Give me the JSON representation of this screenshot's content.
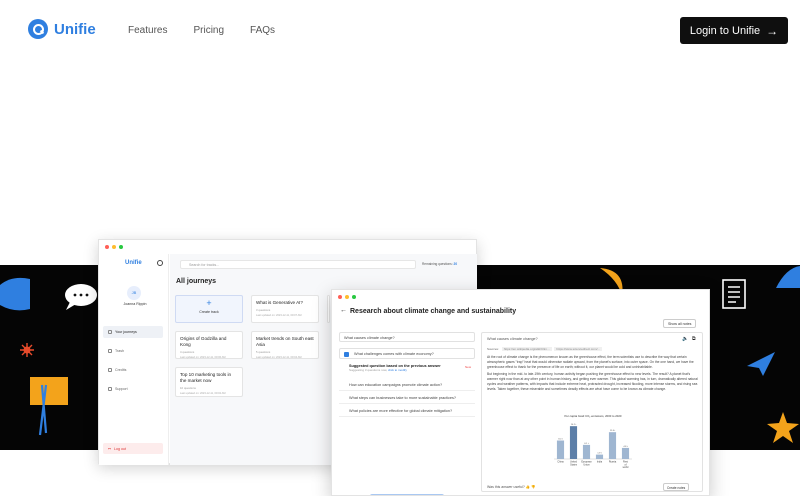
{
  "brand": {
    "name": "Unifie",
    "color": "#2f7fe0"
  },
  "nav": {
    "items": [
      "Features",
      "Pricing",
      "FAQs"
    ]
  },
  "login": {
    "label": "Login to Unifie",
    "icon": "arrow-right-icon"
  },
  "app1": {
    "logo": "Unifie",
    "avatar_initials": "JB",
    "user_name": "Joanna Rippin",
    "sidebar": [
      "Your journeys",
      "Trash",
      "Credits",
      "Support"
    ],
    "logout": "Log out",
    "search_placeholder": "Search for tracks...",
    "remaining_label": "Remaining questions:",
    "remaining_value": "20",
    "heading": "All journeys",
    "create_label": "Create track",
    "cards": [
      {
        "title": "What is Generative AI?",
        "sub": "3 questions",
        "meta": "Last updated on: 2023-12-11, 09:07 AM"
      },
      {
        "title": "Origins of Godzilla and Kong",
        "sub": "4 questions",
        "meta": "Last updated on: 2023-12-11, 09:06 AM"
      },
      {
        "title": "Market trends on South east Asia",
        "sub": "5 questions",
        "meta": "Last updated on: 2023-12-11, 09:04 AM"
      },
      {
        "title": "Top 10 marketing tools in the market now",
        "sub": "10 questions",
        "meta": "Last updated on: 2023-12-11, 09:02 AM"
      }
    ]
  },
  "app2": {
    "title": "Research about climate change and sustainability",
    "show_notes": "Show all notes",
    "q1": "What causes climate change?",
    "q2": "What challenges comes with climate economy?",
    "suggested_title": "Suggested question based on the previous answer",
    "suggested_sub": "Suggesting 3 questions now,",
    "suggested_link": "click to modify",
    "new_label": "New",
    "suggestions": [
      "How can education campaigns promote climate action?",
      "What steps can businesses take to more sustainable practices?",
      "What policies are more effective for global climate mitigation?"
    ],
    "answer_heading": "What causes climate change?",
    "sources_label": "Sources:",
    "sources": [
      "https://en.wikipedia.org/wiki/Clim...",
      "https://www.sciencedirect.com/..."
    ],
    "answer_p1": "At the root of climate change is the phenomenon known as the greenhouse effect, the term scientists use to describe the way that certain atmospheric gases \"trap\" heat that would otherwise radiate upward, from the planet's surface, into outer space. On the one hand, we have the greenhouse effect to thank for the presence of life on earth; without it, our planet would be cold and uninhabitable.",
    "answer_p2": "But beginning in the mid- to late-19th century, human activity began pushing the greenhouse effect to new levels. The result? A planet that's warmer right now than at any other point in human history, and getting ever warmer. This global warming has, in turn, dramatically altered natural cycles and weather patterns, with impacts that include extreme heat, protracted drought, increased flooding, more intense storms, and rising sea levels. Taken together, these miserable and sometimes deadly effects are what have come to be known as climate change.",
    "feedback": "Was this answer useful?",
    "create_notes": "Create notes"
  },
  "chart_data": {
    "type": "bar",
    "title": "Per capita fossil CO₂ emissions, 2000 to 2020",
    "categories": [
      "China",
      "United States",
      "European Union",
      "India",
      "Russia",
      "Rest of world"
    ],
    "values": [
      8.0,
      14.2,
      6.1,
      1.9,
      11.6,
      4.8
    ],
    "value_labels": [
      "8.0 t",
      "14.2 t",
      "6.1 t",
      "1.9 t",
      "11.6 t",
      "4.8 t"
    ],
    "ylim": [
      0,
      16
    ]
  }
}
